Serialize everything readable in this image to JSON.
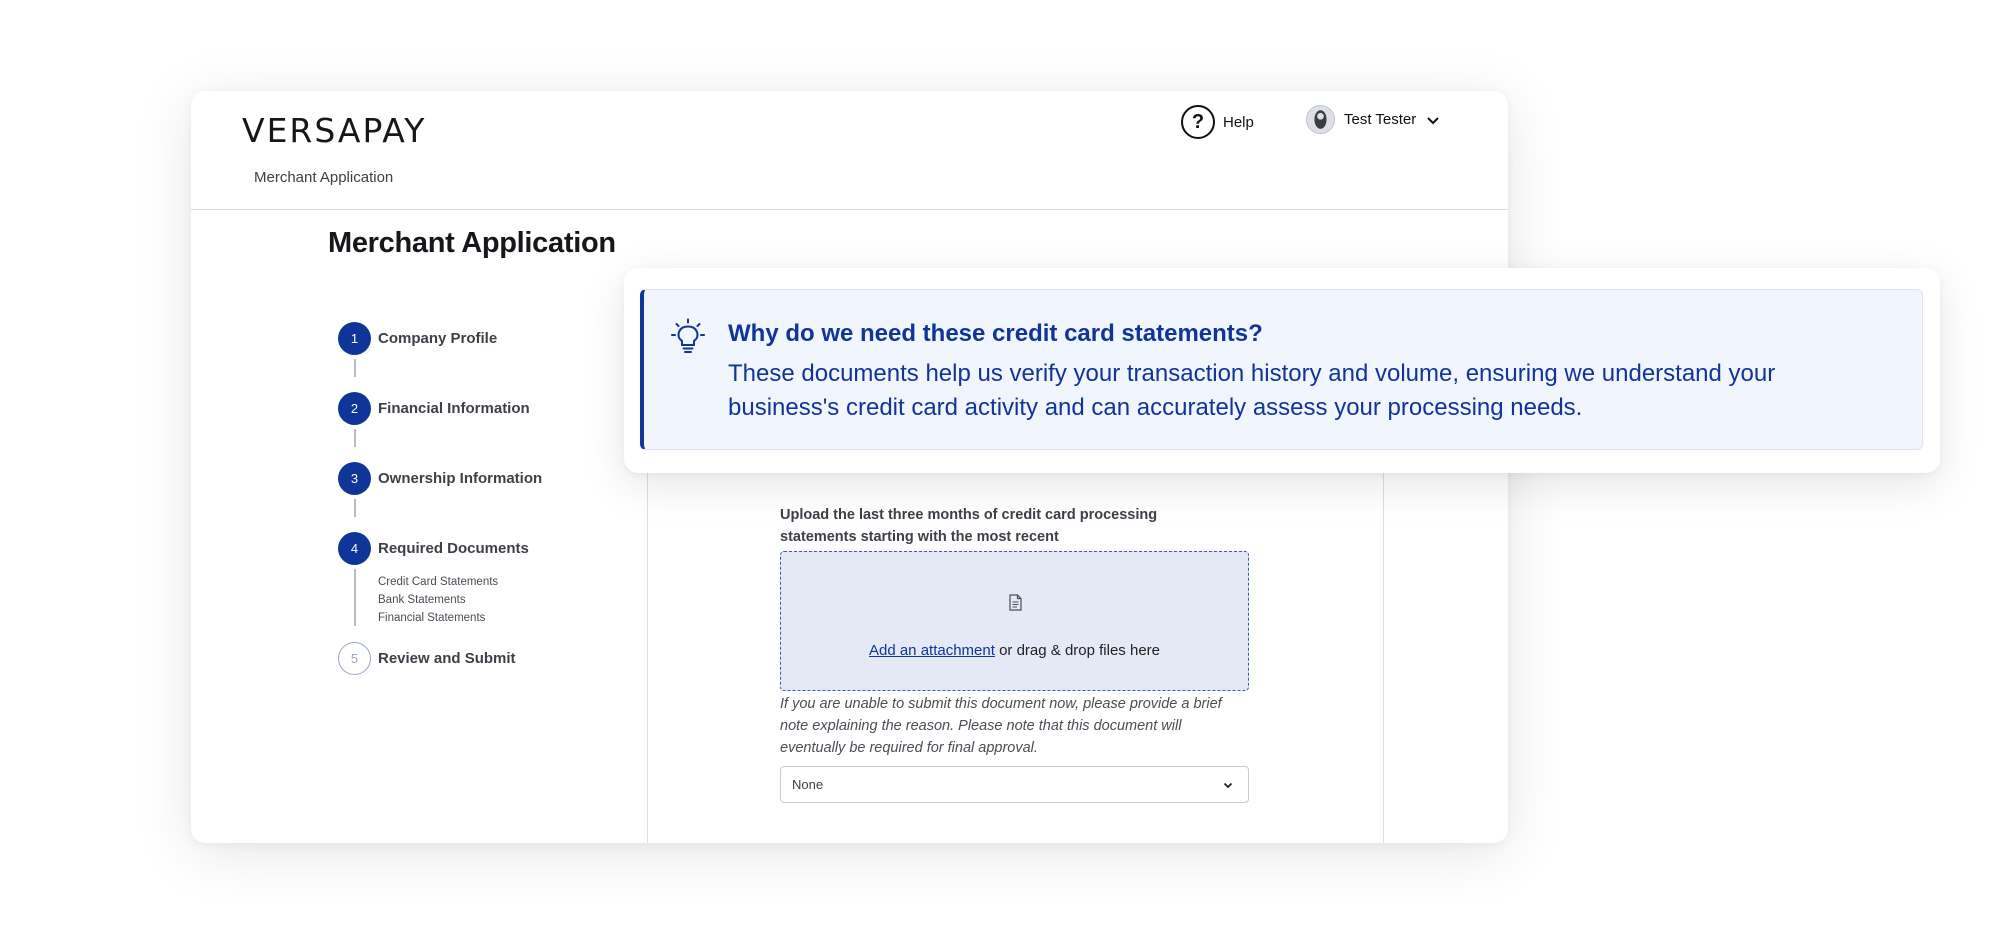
{
  "brand": {
    "logo": "VERSAPAY"
  },
  "header": {
    "breadcrumb": "Merchant Application",
    "help_label": "Help",
    "user_name": "Test Tester"
  },
  "page": {
    "title": "Merchant Application"
  },
  "steps": [
    {
      "number": "1",
      "label": "Company Profile"
    },
    {
      "number": "2",
      "label": "Financial Information"
    },
    {
      "number": "3",
      "label": "Ownership Information"
    },
    {
      "number": "4",
      "label": "Required Documents",
      "substeps": [
        "Credit Card Statements",
        "Bank Statements",
        "Financial Statements"
      ]
    },
    {
      "number": "5",
      "label": "Review and Submit"
    }
  ],
  "upload": {
    "label": "Upload the last three months of credit card processing statements starting with the most recent",
    "link_text": "Add an attachment",
    "drop_text": " or drag & drop files here",
    "note": "If you are unable to submit this document now, please provide a brief note explaining the reason. Please note that this document will eventually be required for final approval.",
    "select_value": "None"
  },
  "tip": {
    "title": "Why do we need these credit card statements?",
    "body": "These documents help us verify your transaction history and volume, ensuring we understand your business's credit card activity and can accurately assess your processing needs."
  },
  "colors": {
    "primary": "#0f3599",
    "tip_background": "#f1f5fd",
    "dropzone_background": "#e5e8f5"
  },
  "icons": {
    "help": "question-circle-icon",
    "user": "avatar-icon",
    "dropdown": "chevron-down-icon",
    "document": "document-icon",
    "tip": "lightbulb-icon"
  }
}
